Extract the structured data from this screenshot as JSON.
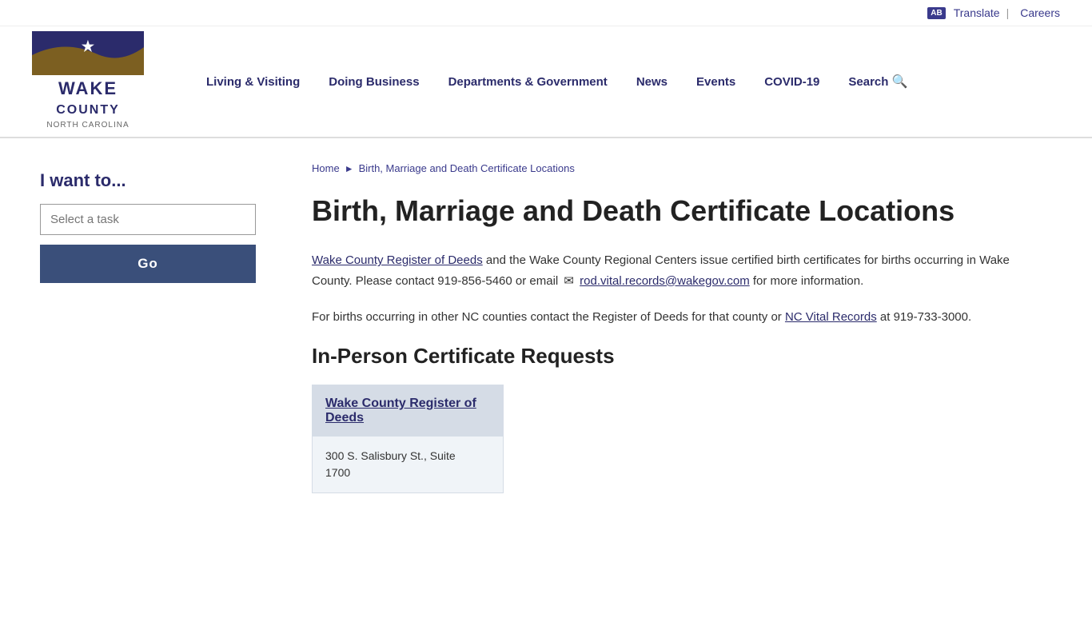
{
  "utility": {
    "translate_icon": "AB",
    "translate_label": "Translate",
    "divider": "|",
    "careers_label": "Careers"
  },
  "logo": {
    "wake_label": "WAKE",
    "county_label": "COUNTY",
    "nc_label": "NORTH CAROLINA"
  },
  "nav": {
    "items": [
      {
        "label": "Living & Visiting",
        "href": "#"
      },
      {
        "label": "Doing Business",
        "href": "#"
      },
      {
        "label": "Departments & Government",
        "href": "#"
      },
      {
        "label": "News",
        "href": "#"
      },
      {
        "label": "Events",
        "href": "#"
      },
      {
        "label": "COVID-19",
        "href": "#"
      },
      {
        "label": "Search",
        "href": "#"
      }
    ]
  },
  "sidebar": {
    "title": "I want to...",
    "task_placeholder": "Select a task",
    "go_label": "Go"
  },
  "breadcrumb": {
    "home": "Home",
    "current": "Birth, Marriage and Death Certificate Locations"
  },
  "main": {
    "page_title": "Birth, Marriage and Death Certificate Locations",
    "intro_paragraph1_prefix": "",
    "register_of_deeds_link": "Wake County Register of Deeds",
    "intro_paragraph1_text": " and the Wake County Regional Centers issue certified birth certificates for births occurring in Wake County. Please contact 919-856-5460 or email ",
    "email_link": "rod.vital.records@wakegov.com",
    "intro_paragraph1_suffix": " for more information.",
    "intro_paragraph2_prefix": "For births occurring in other NC counties contact the Register of Deeds for that county or ",
    "nc_vital_link": "NC Vital Records",
    "intro_paragraph2_suffix": " at 919-733-3000.",
    "section_title": "In-Person Certificate Requests",
    "card": {
      "title": "Wake County Register of Deeds",
      "address_line1": "300 S. Salisbury St., Suite",
      "address_line2": "1700"
    }
  }
}
